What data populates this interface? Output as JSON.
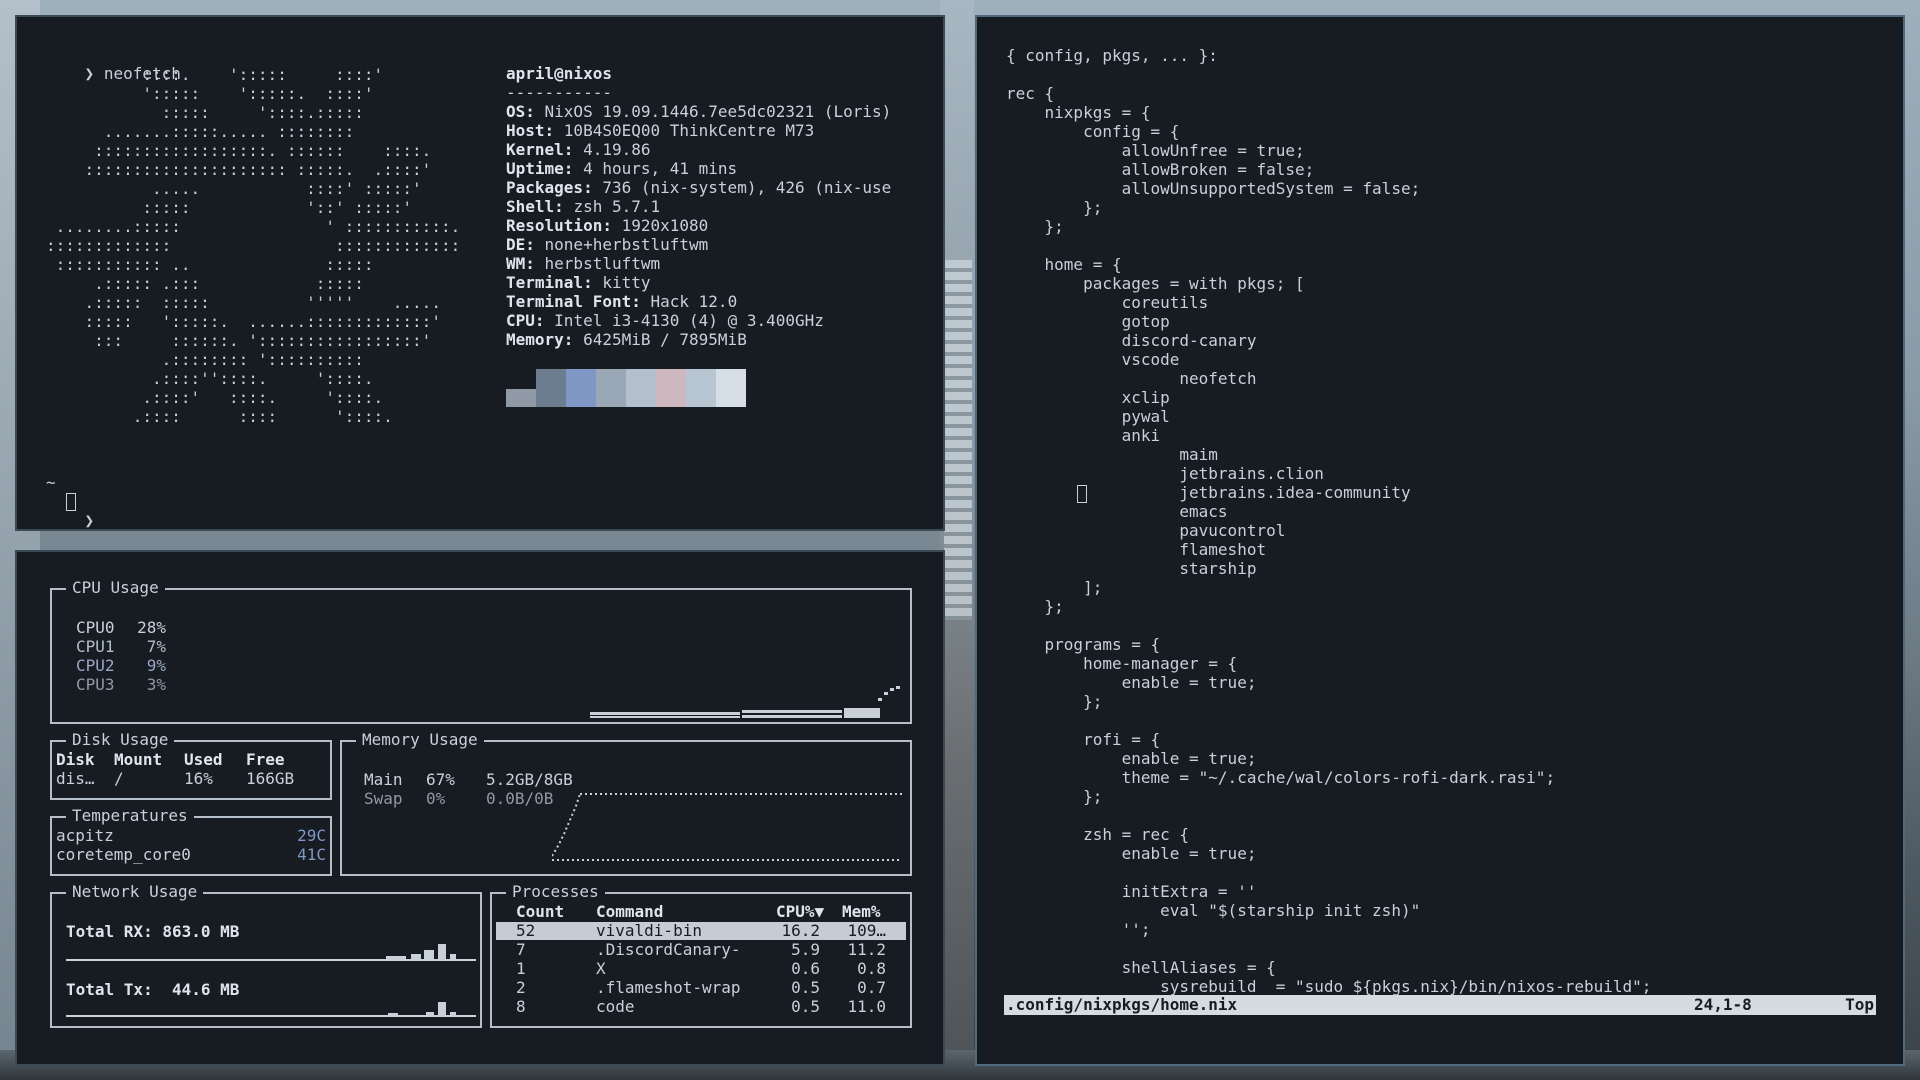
{
  "colors": {
    "bg": "#161c22",
    "fg": "#c8d0da",
    "selection": "#c5ccd4",
    "palette": [
      "#8f9aa6",
      "#6b7d8f",
      "#7f97c4",
      "#9aa7b7",
      "#b3bfcc",
      "#cdb8c0",
      "#b7c4d2",
      "#d5dde6"
    ]
  },
  "terminal": {
    "prompt_symbol": "❯",
    "command": "neofetch",
    "ascii_art": [
      "          ::::.    ':::::     ::::'",
      "          ':::::    ':::::.  ::::'",
      "            :::::     '::::.:::::",
      "      .......:::::..... ::::::::",
      "     ::::::::::::::::::. ::::::    ::::.",
      "    ::::::::::::::::::::: :::::.  .::::'",
      "           .....           ::::' :::::'",
      "          :::::            '::' :::::'",
      " ........:::::               ' :::::::::::.",
      ":::::::::::::                 :::::::::::::",
      " ::::::::::: ..              :::::",
      "     .::::: .:::            :::::",
      "    .:::::  :::::          '''''    .....",
      "    :::::   ':::::.  ......:::::::::::::'",
      "     :::     ::::::. ':::::::::::::::::'",
      "            .:::::::: '::::::::::",
      "           .::::''::::.     '::::.",
      "          .::::'   ::::.     '::::.",
      "         .::::      ::::      '::::."
    ],
    "user_host": "april@nixos",
    "separator": "-----------",
    "info": [
      {
        "key": "OS",
        "value": "NixOS 19.09.1446.7ee5dc02321 (Loris)"
      },
      {
        "key": "Host",
        "value": "10B4S0EQ00 ThinkCentre M73"
      },
      {
        "key": "Kernel",
        "value": "4.19.86"
      },
      {
        "key": "Uptime",
        "value": "4 hours, 41 mins"
      },
      {
        "key": "Packages",
        "value": "736 (nix-system), 426 (nix-use"
      },
      {
        "key": "Shell",
        "value": "zsh 5.7.1"
      },
      {
        "key": "Resolution",
        "value": "1920x1080"
      },
      {
        "key": "DE",
        "value": "none+herbstluftwm"
      },
      {
        "key": "WM",
        "value": "herbstluftwm"
      },
      {
        "key": "Terminal",
        "value": "kitty"
      },
      {
        "key": "Terminal Font",
        "value": "Hack 12.0"
      },
      {
        "key": "CPU",
        "value": "Intel i3-4130 (4) @ 3.400GHz"
      },
      {
        "key": "Memory",
        "value": "6425MiB / 7895MiB"
      }
    ],
    "cwd": "~"
  },
  "gotop": {
    "cpu": {
      "title": "CPU Usage",
      "cores": [
        {
          "name": "CPU0",
          "value": "28%"
        },
        {
          "name": "CPU1",
          "value": "7%"
        },
        {
          "name": "CPU2",
          "value": "9%"
        },
        {
          "name": "CPU3",
          "value": "3%"
        }
      ]
    },
    "disk": {
      "title": "Disk Usage",
      "headers": [
        "Disk",
        "Mount",
        "Used",
        "Free"
      ],
      "row": [
        "dis…",
        "/",
        "16%",
        "166GB"
      ]
    },
    "temps": {
      "title": "Temperatures",
      "rows": [
        {
          "name": "acpitz",
          "value": "29C"
        },
        {
          "name": "coretemp_core0",
          "value": "41C"
        }
      ]
    },
    "memory": {
      "title": "Memory Usage",
      "rows": [
        {
          "name": "Main",
          "pct": "67%",
          "amount": "5.2GB/8GB"
        },
        {
          "name": "Swap",
          "pct": "0%",
          "amount": "0.0B/0B"
        }
      ]
    },
    "network": {
      "title": "Network Usage",
      "rx": "Total RX: 863.0 MB",
      "tx": "Total Tx:  44.6 MB"
    },
    "processes": {
      "title": "Processes",
      "headers": [
        "Count",
        "Command",
        "CPU%▼",
        "Mem%"
      ],
      "rows": [
        [
          "52",
          "vivaldi-bin",
          "16.2",
          "109…"
        ],
        [
          "7",
          ".DiscordCanary-",
          "5.9",
          "11.2"
        ],
        [
          "1",
          "X",
          "0.6",
          "0.8"
        ],
        [
          "2",
          ".flameshot-wrap",
          "0.5",
          "0.7"
        ],
        [
          "8",
          "code",
          "0.5",
          "11.0"
        ]
      ]
    }
  },
  "editor": {
    "lines": [
      "{ config, pkgs, ... }:",
      "",
      "rec {",
      "    nixpkgs = {",
      "        config = {",
      "            allowUnfree = true;",
      "            allowBroken = false;",
      "            allowUnsupportedSystem = false;",
      "        };",
      "    };",
      "",
      "    home = {",
      "        packages = with pkgs; [",
      "            coreutils",
      "            gotop",
      "            discord-canary",
      "            vscode",
      "                  neofetch",
      "            xclip",
      "            pywal",
      "            anki",
      "                  maim",
      "                  jetbrains.clion",
      "                  jetbrains.idea-community",
      "                  emacs",
      "                  pavucontrol",
      "                  flameshot",
      "                  starship",
      "        ];",
      "    };",
      "",
      "    programs = {",
      "        home-manager = {",
      "            enable = true;",
      "        };",
      "",
      "        rofi = {",
      "            enable = true;",
      "            theme = \"~/.cache/wal/colors-rofi-dark.rasi\";",
      "        };",
      "",
      "        zsh = rec {",
      "            enable = true;",
      "",
      "            initExtra = ''",
      "                eval \"$(starship init zsh)\"",
      "            '';",
      "",
      "            shellAliases = {",
      "                sysrebuild  = \"sudo ${pkgs.nix}/bin/nixos-rebuild\";"
    ],
    "status": {
      "file": ".config/nixpkgs/home.nix",
      "position": "24,1-8",
      "scroll": "Top"
    }
  }
}
